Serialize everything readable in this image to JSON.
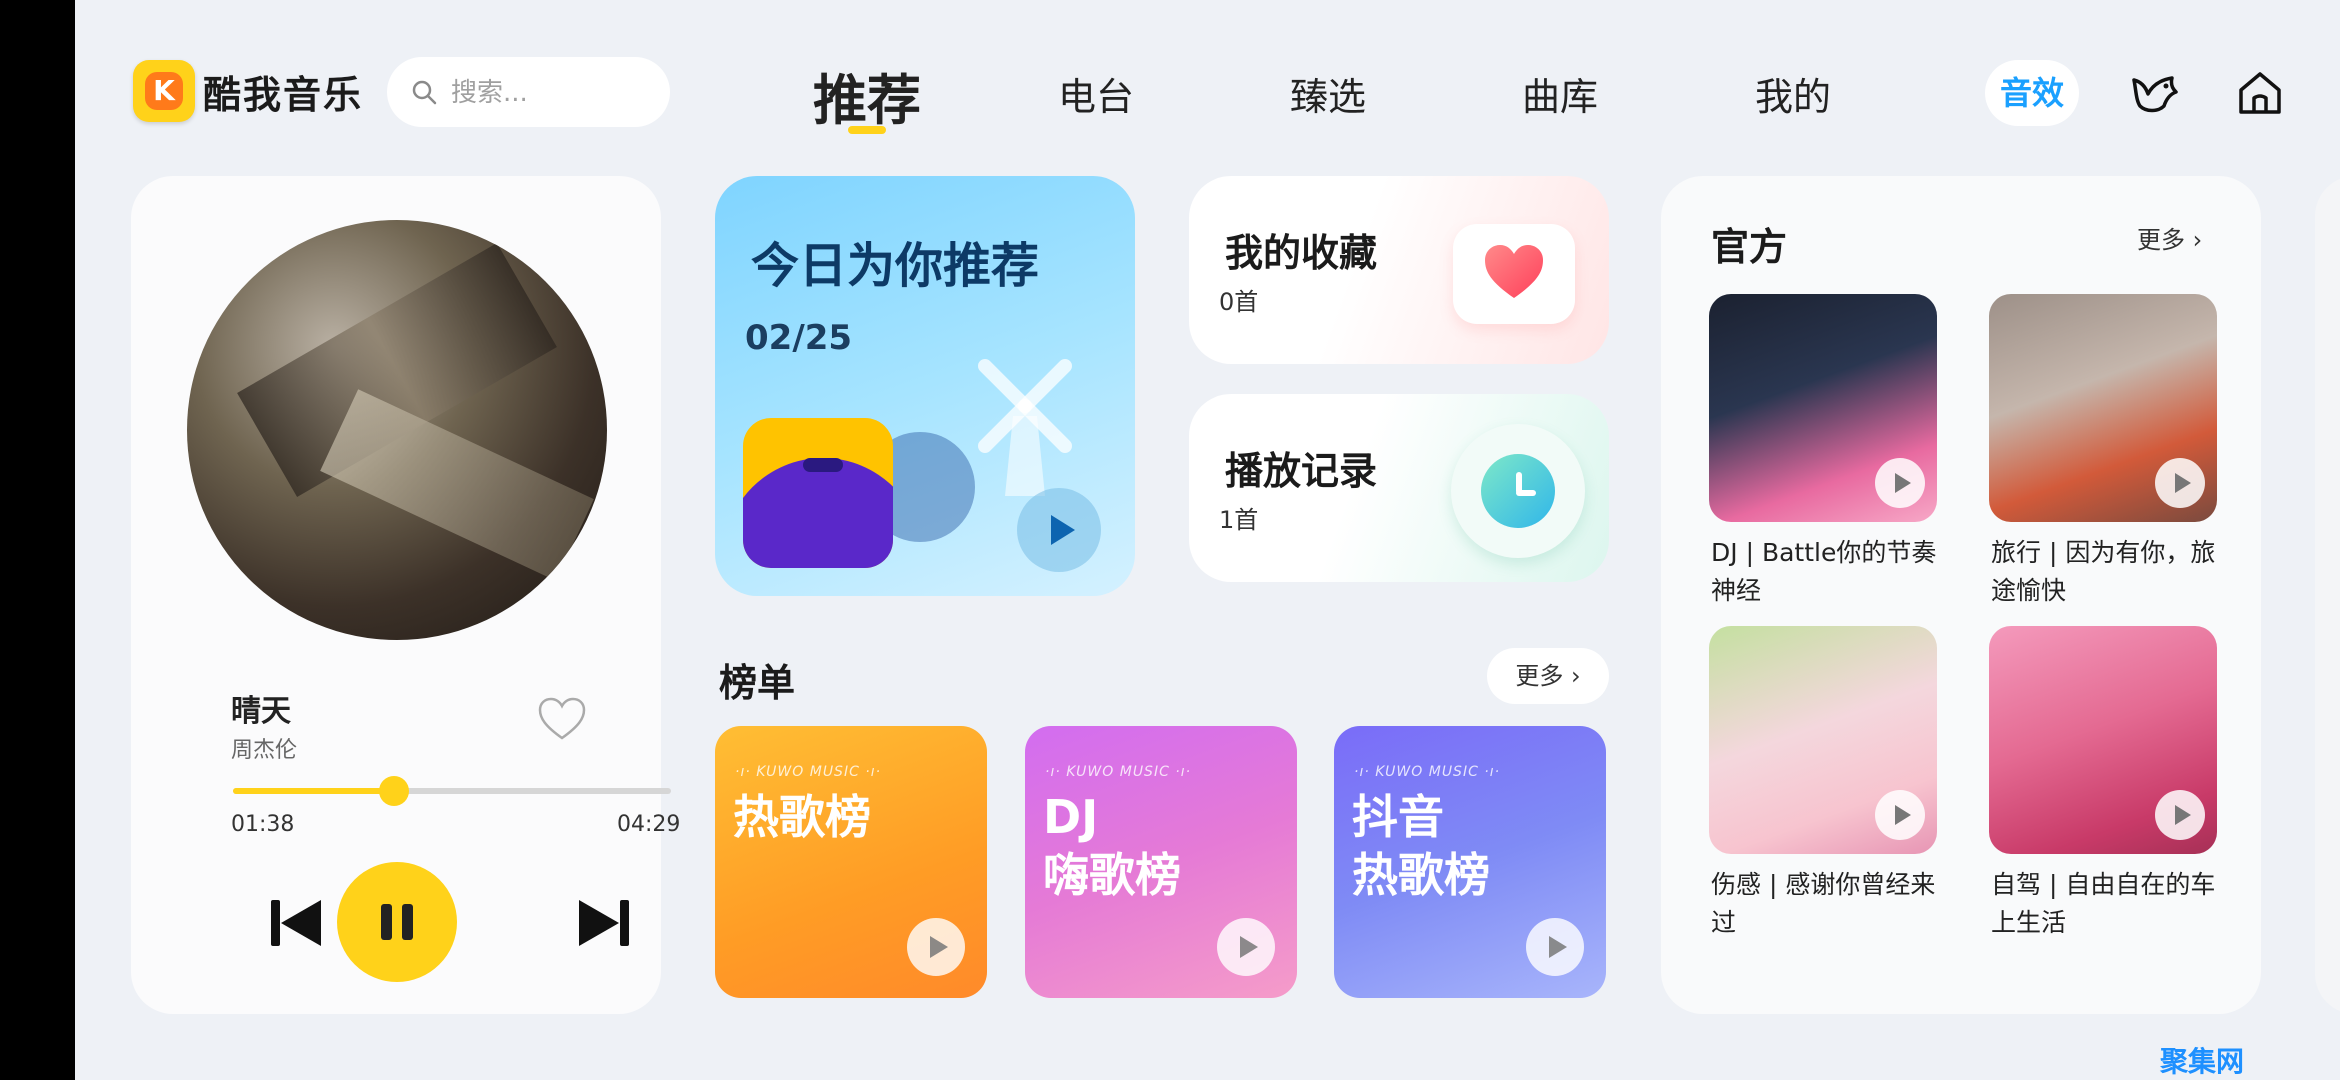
{
  "header": {
    "app_name": "酷我音乐",
    "search_placeholder": "搜索...",
    "tabs": [
      {
        "label": "推荐",
        "active": true
      },
      {
        "label": "电台",
        "active": false
      },
      {
        "label": "臻选",
        "active": false
      },
      {
        "label": "曲库",
        "active": false
      },
      {
        "label": "我的",
        "active": false
      }
    ],
    "sound_effect_label": "音效",
    "icons": [
      "bird-icon",
      "home-icon"
    ]
  },
  "player": {
    "title": "晴天",
    "artist": "周杰伦",
    "current_time": "01:38",
    "total_time": "04:29",
    "progress": 0.367,
    "state": "playing"
  },
  "today_recommend": {
    "title": "今日为你推荐",
    "date": "02/25"
  },
  "favorites": {
    "title": "我的收藏",
    "count": "0首"
  },
  "history": {
    "title": "播放记录",
    "count": "1首"
  },
  "charts": {
    "title": "榜单",
    "more_label": "更多",
    "items": [
      {
        "brand": "·ı· KUWO MUSIC ·ı·",
        "name": "热歌榜"
      },
      {
        "brand": "·ı· KUWO MUSIC ·ı·",
        "name": "DJ\n嗨歌榜"
      },
      {
        "brand": "·ı· KUWO MUSIC ·ı·",
        "name": "抖音\n热歌榜"
      }
    ]
  },
  "official": {
    "title": "官方",
    "more_label": "更多",
    "items": [
      {
        "caption": "DJ | Battle你的节奏神经"
      },
      {
        "caption": "旅行 | 因为有你，旅途愉快"
      },
      {
        "caption": "伤感 | 感谢你曾经来过"
      },
      {
        "caption": "自驾 | 自由自在的车上生活"
      }
    ]
  },
  "watermark": "聚集网",
  "colors": {
    "accent": "#ffd21a",
    "sound_effect": "#1aa0ff"
  }
}
